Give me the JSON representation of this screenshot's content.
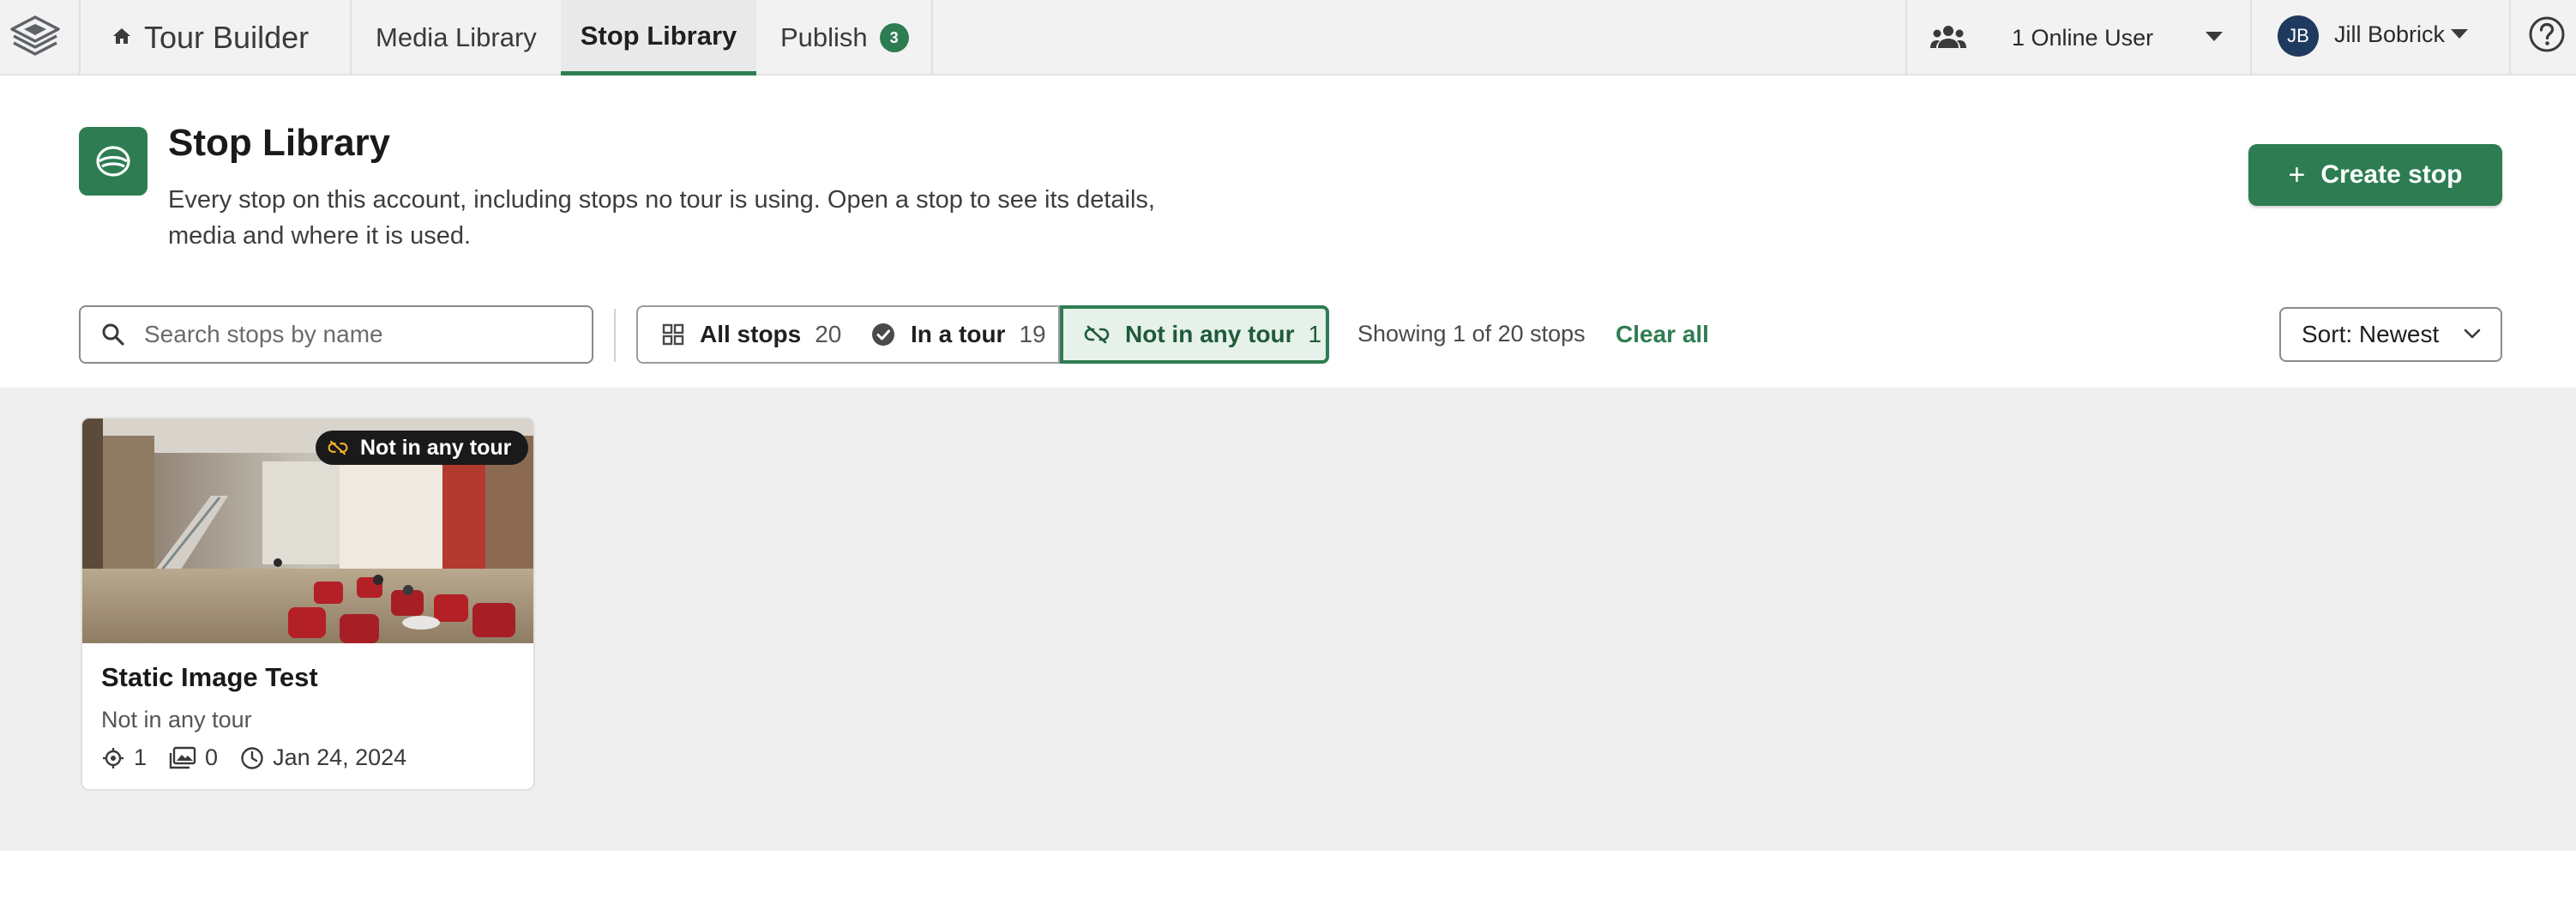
{
  "nav": {
    "tour_builder": "Tour Builder",
    "media_library": "Media Library",
    "stop_library": "Stop Library",
    "publish": "Publish",
    "publish_count": "3",
    "online_users": "1 Online User",
    "avatar_initials": "JB",
    "user_name": "Jill Bobrick"
  },
  "header": {
    "title": "Stop Library",
    "description": "Every stop on this account, including stops no tour is using. Open a stop to see its details, media and where it is used.",
    "create_button": "Create stop"
  },
  "filters": {
    "search_placeholder": "Search stops by name",
    "segments": [
      {
        "label": "All stops",
        "count": "20"
      },
      {
        "label": "In a tour",
        "count": "19"
      },
      {
        "label": "Not in any tour",
        "count": "1",
        "selected": true
      }
    ],
    "showing": "Showing 1 of 20 stops",
    "clear_all": "Clear all",
    "sort": "Sort: Newest"
  },
  "cards": [
    {
      "badge": "Not in any tour",
      "title": "Static Image Test",
      "status": "Not in any tour",
      "location_count": "1",
      "media_count": "0",
      "date": "Jan 24, 2024"
    }
  ],
  "colors": {
    "brand_green": "#2e7d52",
    "nav_bg": "#f2f2f2",
    "grid_bg": "#efefef",
    "avatar_bg": "#1f3a5f"
  },
  "icons": [
    "layers-logo-icon",
    "home-icon",
    "users-icon",
    "help-icon",
    "page-stop-icon",
    "search-icon",
    "grid-icon",
    "check-circle-icon",
    "unlink-icon",
    "chevron-down-icon",
    "location-icon",
    "images-icon",
    "clock-icon"
  ]
}
